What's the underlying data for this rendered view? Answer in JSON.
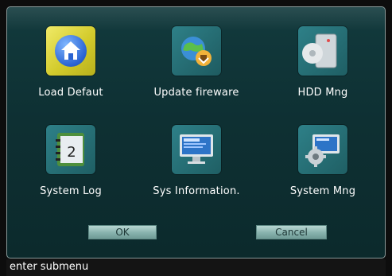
{
  "menu": {
    "items": [
      {
        "label": "Load Defaut",
        "icon": "home-icon"
      },
      {
        "label": "Update fireware",
        "icon": "globe-update-icon"
      },
      {
        "label": "HDD Mng",
        "icon": "hard-disk-icon"
      },
      {
        "label": "System Log",
        "icon": "log-book-icon"
      },
      {
        "label": "Sys Information.",
        "icon": "monitor-icon"
      },
      {
        "label": "System Mng",
        "icon": "settings-monitor-icon"
      }
    ]
  },
  "buttons": {
    "ok_label": "OK",
    "cancel_label": "Cancel"
  },
  "status": {
    "text": "enter submenu"
  },
  "colors": {
    "panel": "#0e3033",
    "tile_accent": "#2e8088",
    "button": "#87b2ad",
    "status_bg": "#141414"
  }
}
